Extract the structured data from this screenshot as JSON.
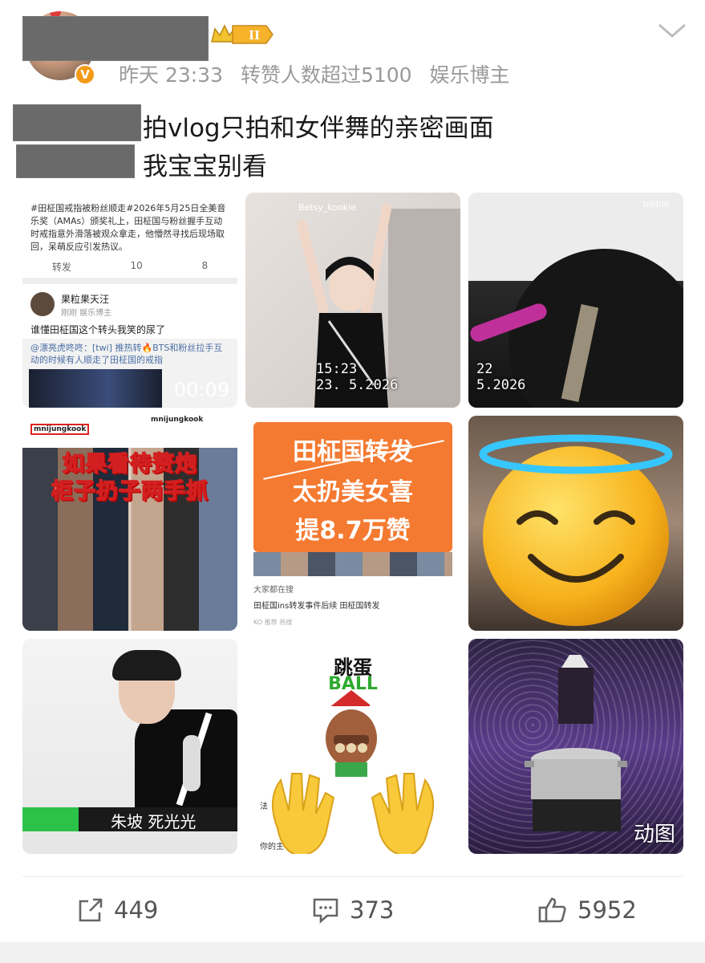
{
  "header": {
    "meta_time": "昨天 23:33",
    "meta_reposts": "转赞人数超过5100",
    "meta_role": "娱乐博主",
    "rank_badge": "II"
  },
  "post": {
    "line1": "拍vlog只拍和女伴舞的亲密画面",
    "line2": "我宝宝别看"
  },
  "tiles": {
    "t1": {
      "para": "#田柾国戒指被粉丝顺走#2026年5月25日全美音乐奖（AMAs）颁奖礼上，田柾国与粉丝握手互动时戒指意外滑落被观众拿走，他懵然寻找后现场取回，呆萌反应引发热议。",
      "repost": "转发",
      "comments": "10",
      "likes": "8",
      "user": "果粒果天汪",
      "user_sub": "刚刚 娱乐博主",
      "msg": "谁懂田柾国这个转头我笑的尿了",
      "quote": "@漂亮虎咚咚：[twi] 推热转🔥BTS和粉丝拉手互动的时候有人顺走了田柾国的戒指",
      "duration": "00:09"
    },
    "t2": {
      "watermark": "Betsy_kookie",
      "ts1": "15:23",
      "ts2": "23. 5.2026"
    },
    "t3": {
      "watermark": "bilibili",
      "ts1": "22",
      "ts2": "5.2026"
    },
    "t4": {
      "username": "mnijungkook",
      "username2": "mnijungkook",
      "text1": "如果看待赘炮",
      "text2": "柜子扔子两手抓"
    },
    "t5": {
      "line1": "田柾国转发",
      "line2": "太扔美女喜",
      "line3": "提8.7万赞",
      "small1": "大家都在搜",
      "small2": "田柾国ins转发事件后续    田柾国转发",
      "small3": "KO 推荐 热搜"
    },
    "t7": {
      "caption": "朱坡 死光光"
    },
    "t8": {
      "title": "跳蛋",
      "subtitle": "BALL",
      "side1": "法",
      "side2": "你的主"
    },
    "t9": {
      "tag": "动图"
    }
  },
  "actions": {
    "repost_count": "449",
    "comment_count": "373",
    "like_count": "5952"
  },
  "colors": {
    "meta_gray": "#9a9a9a",
    "orange_card": "#f47a31",
    "verified_badge": "#f39a16"
  }
}
